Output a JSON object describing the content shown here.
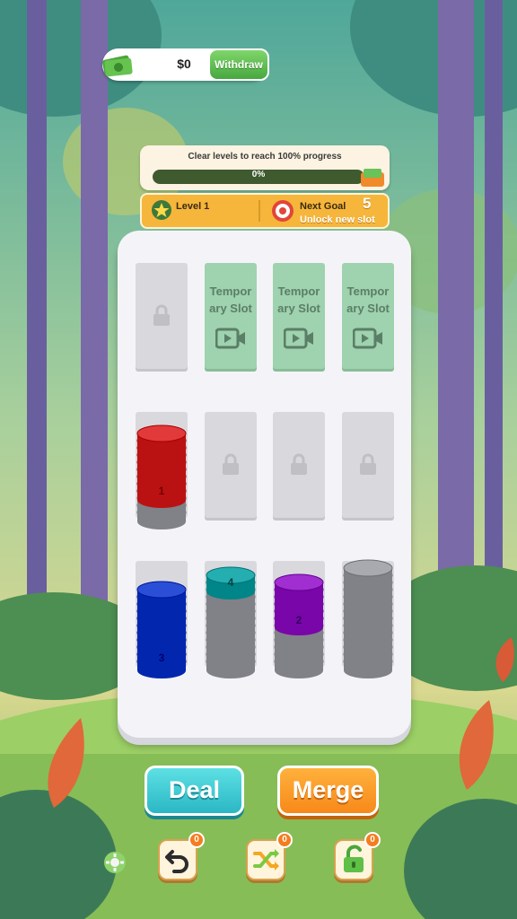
{
  "header": {
    "cash_value": "$0",
    "withdraw_label": "Withdraw"
  },
  "progress": {
    "caption": "Clear levels to reach 100% progress",
    "percent_text": "0%",
    "fraction": 0
  },
  "level_bar": {
    "level_label": "Level 1",
    "goal_title": "Next Goal",
    "goal_count": "5",
    "goal_subtitle": "Unlock new slot"
  },
  "board": {
    "temp_slot_label": "Tempor\nary Slot",
    "stacks": [
      {
        "color": "#e23a3a",
        "count": "1"
      },
      {
        "color": "#2a4fd6",
        "count": "3"
      },
      {
        "color": "#25aeb0",
        "count": "4"
      },
      {
        "color": "#a12ed0",
        "count": "2"
      }
    ]
  },
  "actions": {
    "deal_label": "Deal",
    "merge_label": "Merge"
  },
  "tools": {
    "undo_count": "0",
    "shuffle_count": "0",
    "unlock_count": "0"
  },
  "colors": {
    "deal": "#2bb7c4",
    "merge": "#f7891a",
    "progress_fill": "#8cd35e",
    "level_bar": "#f6b63b"
  }
}
